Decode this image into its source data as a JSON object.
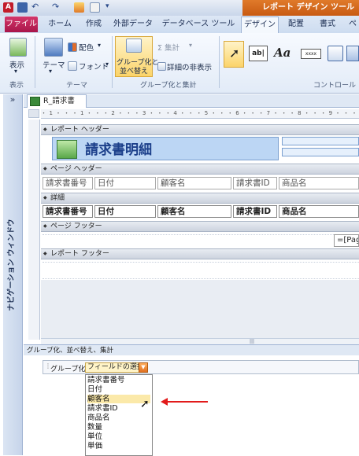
{
  "title_bar": {
    "app_icon": "A",
    "context_title": "レポート デザイン ツール"
  },
  "ribbon_tabs": [
    "ファイル",
    "ホーム",
    "作成",
    "外部データ",
    "データベース ツール",
    "デザイン",
    "配置",
    "書式",
    "ペ"
  ],
  "ribbon": {
    "view": {
      "label": "表示",
      "group": "表示"
    },
    "theme": {
      "theme_label": "テーマ",
      "color_label": "配色",
      "font_label": "フォント",
      "group": "テーマ"
    },
    "grouping": {
      "group_sort_label_line1": "グループ化と",
      "group_sort_label_line2": "並べ替え",
      "totals_label": "Σ 集計",
      "hide_details_label": "詳細の非表示",
      "group": "グループ化と集計"
    },
    "controls": {
      "group": "コントロール",
      "xxxx_label": "xxxx",
      "ab_label": "ab|",
      "aa_label": "Aa"
    }
  },
  "nav_pane": {
    "toggle": "»",
    "label": "ナビゲーション ウィンドウ"
  },
  "document_tab": "R_請求書",
  "ruler": "・1・・・1・・・2・・・3・・・4・・・5・・・6・・・7・・・8・・・9・・・10・",
  "sections": {
    "report_header": "レポート ヘッダー",
    "page_header": "ページ ヘッダー",
    "detail": "詳細",
    "page_footer": "ページ フッター",
    "report_footer": "レポート フッター"
  },
  "report_title": "請求書明細",
  "page_footer_field": "=[Pag",
  "header_fields": [
    "請求書番号",
    "日付",
    "顧客名",
    "請求書ID",
    "商品名"
  ],
  "detail_fields": [
    "請求書番号",
    "日付",
    "顧客名",
    "請求書ID",
    "商品名"
  ],
  "group_pane": {
    "title": "グループ化、並べ替え、集計",
    "row_label": "グループ化:",
    "field_select": "フィールドの選択",
    "options": [
      "請求書番号",
      "日付",
      "顧客名",
      "請求書ID",
      "商品名",
      "数量",
      "単位",
      "単価"
    ],
    "selected_index": 2
  },
  "colors": {
    "accent_file_tab": "#c2195a",
    "context_orange": "#d86a1e",
    "annotation_arrow": "#e21b1b",
    "title_text": "#1c3f8a"
  }
}
